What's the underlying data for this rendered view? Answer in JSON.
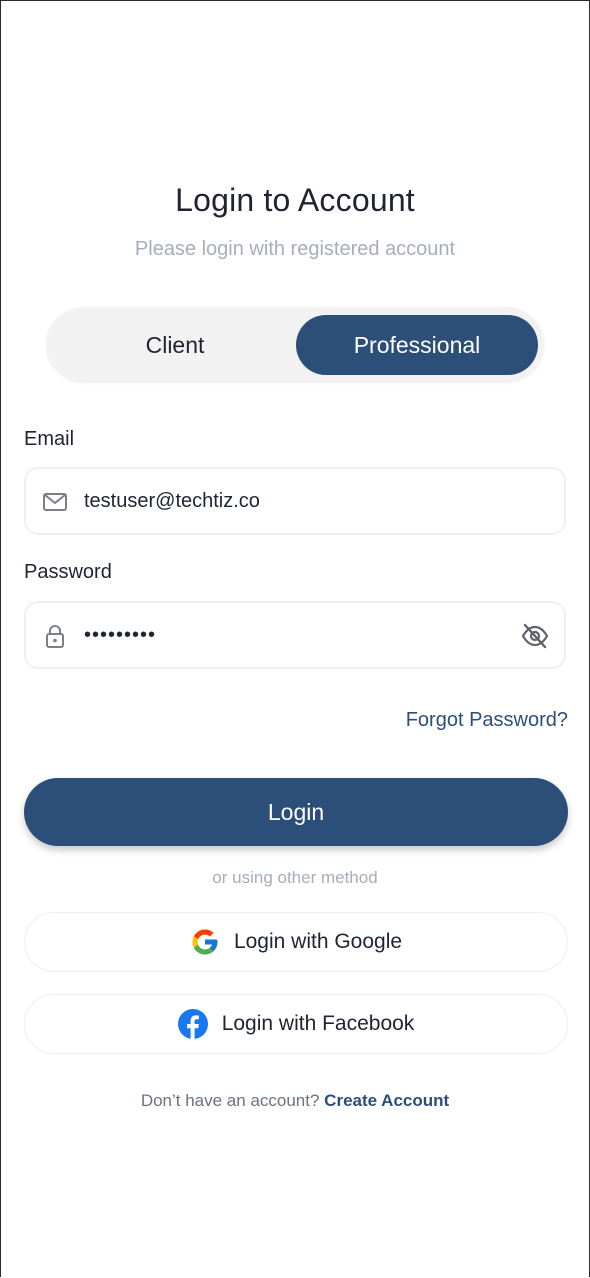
{
  "header": {
    "title": "Login to Account",
    "subtitle": "Please login with registered account"
  },
  "role_toggle": {
    "options": [
      "Client",
      "Professional"
    ],
    "selected": "Professional"
  },
  "email": {
    "label": "Email",
    "value": "testuser@techtiz.co",
    "icon": "mail-icon"
  },
  "password": {
    "label": "Password",
    "value": "•••••••••",
    "icon": "lock-icon",
    "visibility_icon": "eye-off-icon"
  },
  "forgot_password": "Forgot Password?",
  "login_button": "Login",
  "divider_text": "or using other method",
  "social": {
    "google_label": "Login with Google",
    "facebook_label": "Login with Facebook"
  },
  "footer": {
    "prompt": "Don’t have an account?",
    "link": "Create Account"
  },
  "colors": {
    "primary": "#2c4f79",
    "muted_text": "#a6adbb",
    "facebook_blue": "#1877f2"
  }
}
